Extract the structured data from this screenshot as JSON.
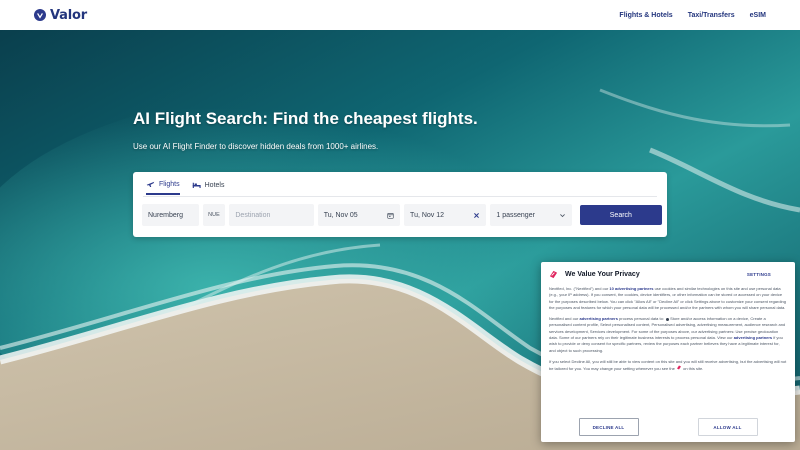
{
  "header": {
    "logo_text": "Valor",
    "nav": [
      "Flights & Hotels",
      "Taxi/Transfers",
      "eSIM"
    ]
  },
  "hero": {
    "title": "AI Flight Search: Find the cheapest flights.",
    "subtitle": "Use our AI Flight Finder to discover hidden deals from 1000+ airlines."
  },
  "search": {
    "tabs": [
      {
        "label": "Flights",
        "icon": "plane-icon",
        "active": true
      },
      {
        "label": "Hotels",
        "icon": "bed-icon",
        "active": false
      }
    ],
    "origin_value": "Nuremberg",
    "origin_code": "NUE",
    "destination_placeholder": "Destination",
    "depart_date": "Tu, Nov 05",
    "return_date": "Tu, Nov 12",
    "passengers": "1 passenger",
    "search_label": "Search"
  },
  "privacy": {
    "title": "We Value Your Privacy",
    "settings_label": "SETTINGS",
    "p1_a": "Nextfied, Inc. (\"Nextfied\") and our ",
    "p1_link": "10 advertising partners",
    "p1_b": " use cookies and similar technologies on this site and use personal data (e.g., your IP address). If you consent, the cookies, device identifiers, or other information can be stored or accessed on your device for the purposes described below. You can click \"Allow All\" or \"Decline All\" or click Settings above to customize your consent regarding the purposes and features for which your personal data will be processed and/or the partners with whom you will share personal data.",
    "p2_a": "Nextfied and our ",
    "p2_link": "advertising partners",
    "p2_b": " process personal data to: ",
    "p2_items": "Store and/or access information on a device, Create a personalised content profile, Select personalised content, Personalised advertising, advertising measurement, audience research and services development, Services development. For some of the purposes above, our advertising partners: Use precise geolocation data. Some of our partners rely on their legitimate business interests to process personal data. View our ",
    "p2_link2": "advertising partners",
    "p2_c": " if you wish to provide or deny consent for specific partners, review the purposes each partner believes they have a legitimate interest for, and object to such processing.",
    "p3_a": "If you select Decline All, you will still be able to view content on this site and you will still receive advertising, but the advertising will not be tailored for you. You may change your setting whenever you see the",
    "p3_b": "on this site.",
    "decline_label": "DECLINE ALL",
    "allow_label": "ALLOW ALL"
  },
  "colors": {
    "brand": "#2c3a8c",
    "header_bg": "#ffffff",
    "privacy_accent": "#e0245e"
  }
}
